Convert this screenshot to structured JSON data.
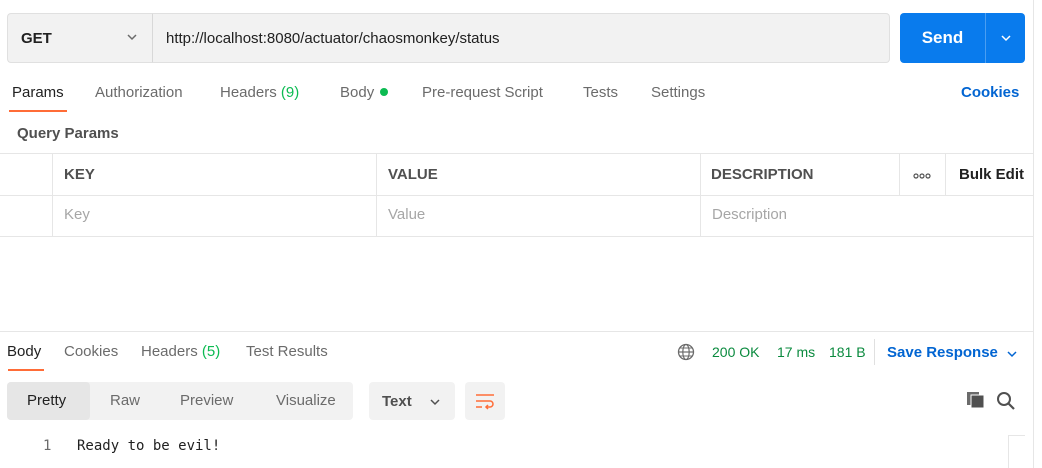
{
  "request": {
    "method": "GET",
    "url": "http://localhost:8080/actuator/chaosmonkey/status",
    "send_label": "Send"
  },
  "request_tabs": {
    "params": "Params",
    "authorization": "Authorization",
    "headers": "Headers",
    "headers_count": "(9)",
    "body": "Body",
    "prerequest": "Pre-request Script",
    "tests": "Tests",
    "settings": "Settings",
    "cookies": "Cookies"
  },
  "query_params": {
    "title": "Query Params",
    "columns": [
      "KEY",
      "VALUE",
      "DESCRIPTION"
    ],
    "bulk_edit": "Bulk Edit",
    "placeholders": {
      "key": "Key",
      "value": "Value",
      "description": "Description"
    }
  },
  "response_tabs": {
    "body": "Body",
    "cookies": "Cookies",
    "headers": "Headers",
    "headers_count": "(5)",
    "test_results": "Test Results"
  },
  "response_meta": {
    "status": "200 OK",
    "time": "17 ms",
    "size": "181 B",
    "save_label": "Save Response"
  },
  "format": {
    "modes": [
      "Pretty",
      "Raw",
      "Preview",
      "Visualize"
    ],
    "active_mode": "Pretty",
    "language": "Text"
  },
  "response_body": {
    "lines": [
      {
        "num": "1",
        "text": "Ready to be evil!"
      }
    ]
  },
  "icons": {
    "method_dropdown": "chevron-down-icon",
    "send_dropdown": "chevron-down-icon",
    "more": "more-horizontal-icon",
    "network": "globe-icon",
    "wrap": "word-wrap-icon",
    "copy": "copy-icon",
    "search": "search-icon"
  },
  "colors": {
    "accent_orange": "#ff6c37",
    "send_blue": "#097bed",
    "link_blue": "#0265d2",
    "status_green": "#0a8a3e",
    "count_green": "#0cbb52"
  }
}
